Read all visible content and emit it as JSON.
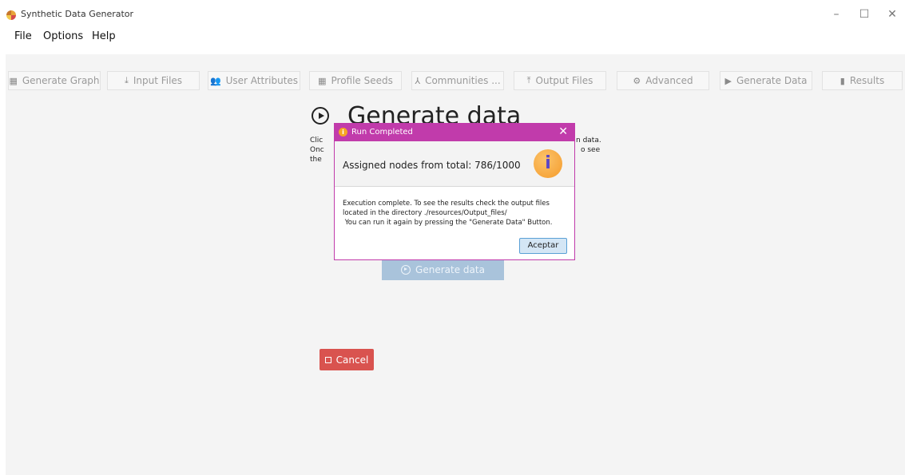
{
  "window": {
    "title": "Synthetic Data Generator",
    "controls": {
      "minimize": "–",
      "maximize": "☐",
      "close": "✕"
    }
  },
  "menu": [
    "File",
    "Options",
    "Help"
  ],
  "tabs": [
    {
      "icon": "grid-icon",
      "glyph": "▦",
      "label": "Generate Graph"
    },
    {
      "icon": "download-icon",
      "glyph": "⤓",
      "label": "Input Files"
    },
    {
      "icon": "users-icon",
      "glyph": "👥",
      "label": "User Attributes"
    },
    {
      "icon": "grid-icon",
      "glyph": "▦",
      "label": "Profile Seeds"
    },
    {
      "icon": "network-icon",
      "glyph": "⅄",
      "label": "Communities ..."
    },
    {
      "icon": "upload-icon",
      "glyph": "⤒",
      "label": "Output Files"
    },
    {
      "icon": "gear-icon",
      "glyph": "⚙",
      "label": "Advanced"
    },
    {
      "icon": "play-icon",
      "glyph": "▶",
      "label": "Generate Data"
    },
    {
      "icon": "bar-chart-icon",
      "glyph": "▮",
      "label": "Results"
    }
  ],
  "page": {
    "heading": "Generate data",
    "description_line1_left": "Clic",
    "description_line1_right": "n data.",
    "description_line2_left": "Onc",
    "description_line2_right": "o see",
    "description_line3_left": "the",
    "generate_button": "Generate data",
    "cancel_button": "Cancel"
  },
  "dialog": {
    "title": "Run Completed",
    "header_message": "Assigned nodes from total: 786/1000",
    "body": "Execution complete. To see the results check the output files\nlocated in the directory ./resources/Output_files/\n You can run it again by pressing the \"Generate Data\" Button.",
    "ok_button": "Aceptar",
    "close_glyph": "✕"
  },
  "colors": {
    "dialog_title_bar": "#c13bab",
    "generate_button": "#a9c3db",
    "cancel_button": "#d9534f",
    "info_icon": "#f59b2a"
  }
}
